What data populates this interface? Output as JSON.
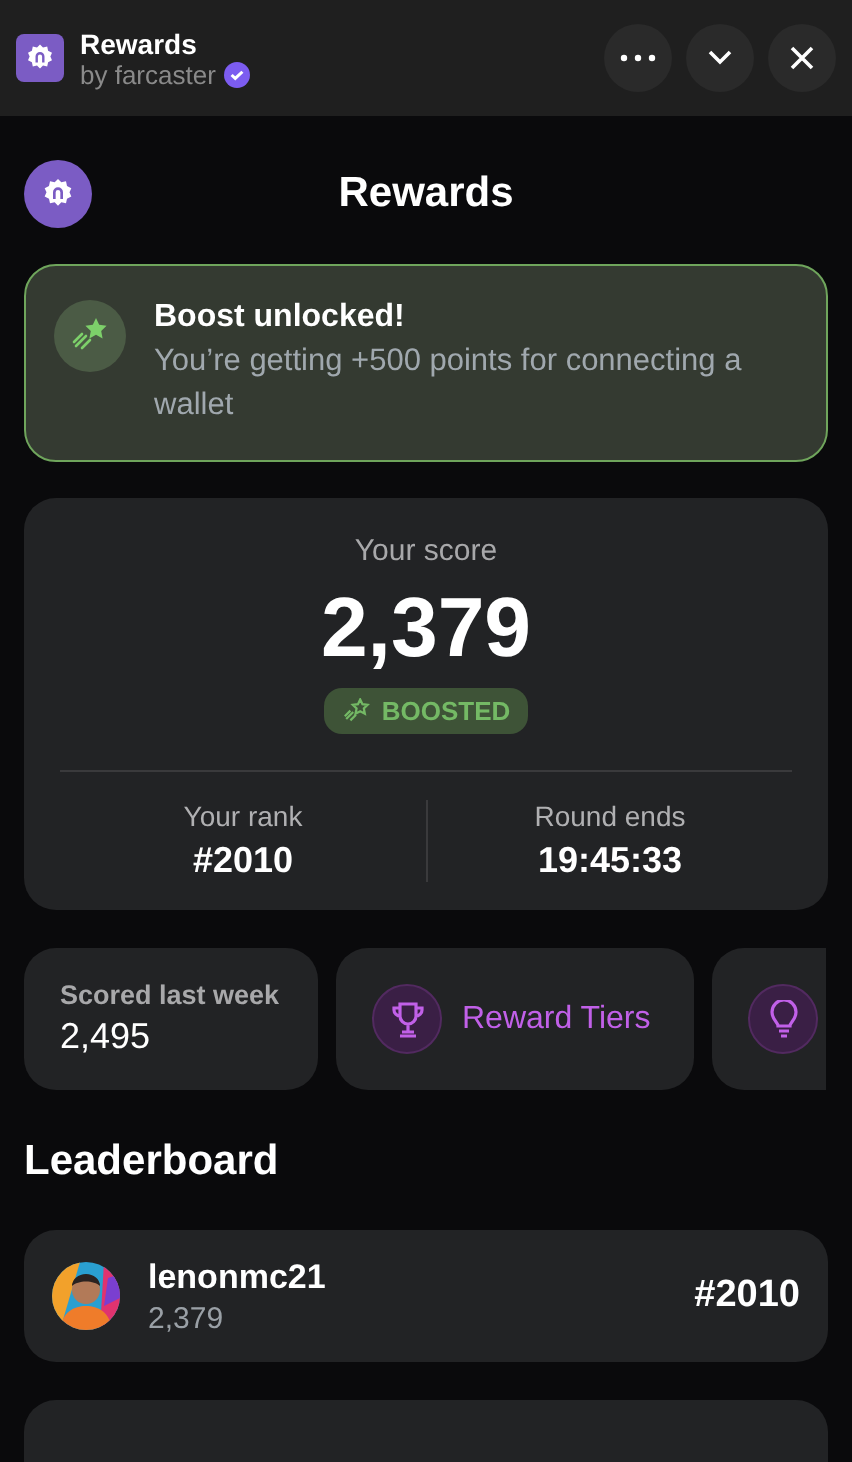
{
  "header": {
    "title": "Rewards",
    "subtitle": "by farcaster",
    "verified": true
  },
  "page": {
    "title": "Rewards"
  },
  "banner": {
    "title": "Boost unlocked!",
    "text": "You’re getting +500 points for connecting a wallet"
  },
  "score": {
    "label": "Your score",
    "value": "2,379",
    "badge": "BOOSTED",
    "rank_label": "Your rank",
    "rank": "#2010",
    "round_label": "Round ends",
    "round": "19:45:33"
  },
  "tiles": [
    {
      "kind": "stat",
      "label": "Scored last week",
      "value": "2,495"
    },
    {
      "kind": "trophy",
      "label": "Reward Tiers"
    },
    {
      "kind": "bulb"
    }
  ],
  "leaderboard": {
    "title": "Leaderboard",
    "rows": [
      {
        "name": "lenonmc21",
        "score": "2,379",
        "rank": "#2010"
      }
    ]
  }
}
